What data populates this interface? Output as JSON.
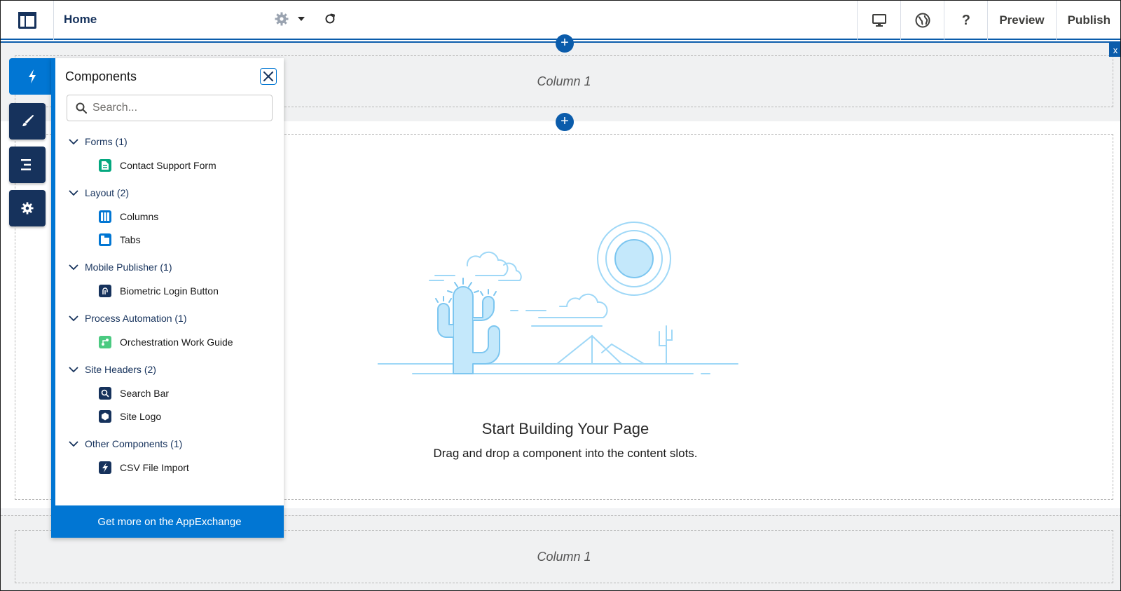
{
  "topbar": {
    "page_title": "Home",
    "preview_label": "Preview",
    "publish_label": "Publish",
    "help_label": "?"
  },
  "canvas": {
    "top_column_label": "Column 1",
    "bottom_column_label": "Column 1",
    "close_label": "x",
    "plus_label": "+",
    "empty_title": "Start Building Your Page",
    "empty_subtitle": "Drag and drop a component into the content slots."
  },
  "panel": {
    "title": "Components",
    "search_placeholder": "Search...",
    "footer_label": "Get more on the AppExchange",
    "categories": [
      {
        "label": "Forms (1)",
        "items": [
          {
            "label": "Contact Support Form",
            "icon": "form-icon",
            "color": "#04a87f"
          }
        ]
      },
      {
        "label": "Layout (2)",
        "items": [
          {
            "label": "Columns",
            "icon": "columns-icon",
            "color": "#0176d3"
          },
          {
            "label": "Tabs",
            "icon": "tabs-icon",
            "color": "#0176d3"
          }
        ]
      },
      {
        "label": "Mobile Publisher (1)",
        "items": [
          {
            "label": "Biometric Login Button",
            "icon": "fingerprint-icon",
            "color": "#16325c"
          }
        ]
      },
      {
        "label": "Process Automation (1)",
        "items": [
          {
            "label": "Orchestration Work Guide",
            "icon": "orchestration-icon",
            "color": "#4bca81"
          }
        ]
      },
      {
        "label": "Site Headers (2)",
        "items": [
          {
            "label": "Search Bar",
            "icon": "search-bar-icon",
            "color": "#16325c"
          },
          {
            "label": "Site Logo",
            "icon": "site-logo-icon",
            "color": "#16325c"
          }
        ]
      },
      {
        "label": "Other Components (1)",
        "items": [
          {
            "label": "CSV File Import",
            "icon": "lightning-icon",
            "color": "#16325c"
          }
        ]
      }
    ]
  },
  "colors": {
    "brand_blue": "#0176d3",
    "navy": "#16325c",
    "selection_blue": "#0b5cab"
  }
}
